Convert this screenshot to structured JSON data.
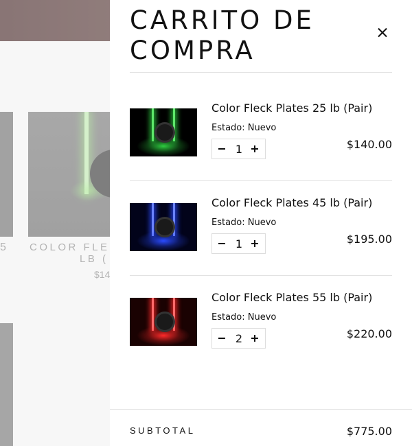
{
  "background": {
    "left_fragment": "5",
    "product_title_line1": "COLOR FLEC",
    "product_title_line2": "LB (",
    "product_price": "$14"
  },
  "cart": {
    "title": "CARRITO DE COMPRA",
    "close_icon": "close-icon",
    "items": [
      {
        "name": "Color Fleck Plates 25 lb (Pair)",
        "state": "Estado: Nuevo",
        "quantity": "1",
        "price": "$140.00",
        "accent": "#2ecc40"
      },
      {
        "name": "Color Fleck Plates 45 lb (Pair)",
        "state": "Estado: Nuevo",
        "quantity": "1",
        "price": "$195.00",
        "accent": "#2a4bff"
      },
      {
        "name": "Color Fleck Plates 55 lb (Pair)",
        "state": "Estado: Nuevo",
        "quantity": "2",
        "price": "$220.00",
        "accent": "#ff2a2a"
      }
    ],
    "subtotal_label": "SUBTOTAL",
    "subtotal_value": "$775.00"
  }
}
